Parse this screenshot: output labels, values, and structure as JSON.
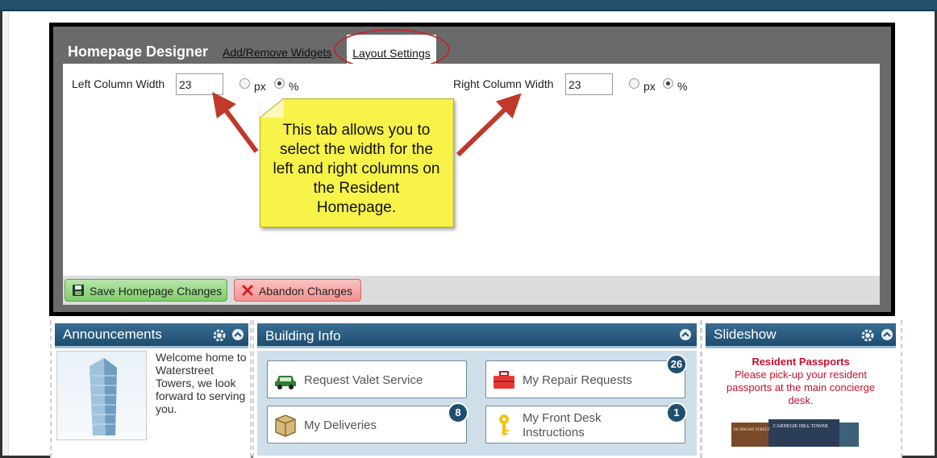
{
  "designer": {
    "title": "Homepage Designer",
    "tabs": [
      {
        "label": "Add/Remove Widgets",
        "active": false
      },
      {
        "label": "Layout Settings",
        "active": true
      }
    ],
    "left_column": {
      "label": "Left Column Width",
      "value": "23",
      "unit_px": "px",
      "unit_pct": "%",
      "selected_unit": "%"
    },
    "right_column": {
      "label": "Right Column Width",
      "value": "23",
      "unit_px": "px",
      "unit_pct": "%",
      "selected_unit": "%"
    },
    "save_label": "Save Homepage Changes",
    "abandon_label": "Abandon Changes"
  },
  "callout": {
    "lines": [
      "This tab allows you to",
      "select the width for the",
      "left and right columns on",
      "the Resident",
      "Homepage."
    ]
  },
  "announcements": {
    "title": "Announcements",
    "text_lines": [
      "Welcome home to",
      "Waterstreet",
      "Towers, we look",
      "forward to serving",
      "you."
    ]
  },
  "building_info": {
    "title": "Building Info",
    "items": [
      {
        "label": "Request Valet Service",
        "icon": "car-icon",
        "count": null
      },
      {
        "label": "My Repair Requests",
        "icon": "toolbox-icon",
        "count": "26"
      },
      {
        "label": "My Deliveries",
        "icon": "package-icon",
        "count": "8"
      },
      {
        "label": "My Front Desk",
        "label2": "Instructions",
        "icon": "key-icon",
        "count": "1"
      }
    ]
  },
  "slideshow": {
    "title": "Slideshow",
    "heading": "Resident Passports",
    "text_lines": [
      "Please pick-up your resident",
      "passports at the main concierge",
      "desk."
    ],
    "image_caption": "CARNEGIE HILL TOWER",
    "image_caption_2": "192 BROAD STREET"
  },
  "colors": {
    "header_blue": "#1e4c6e",
    "callout_yellow": "#f7f348",
    "annotation_red": "#c0262d",
    "save_green": "#7fcc6c",
    "abandon_red": "#f29191"
  }
}
